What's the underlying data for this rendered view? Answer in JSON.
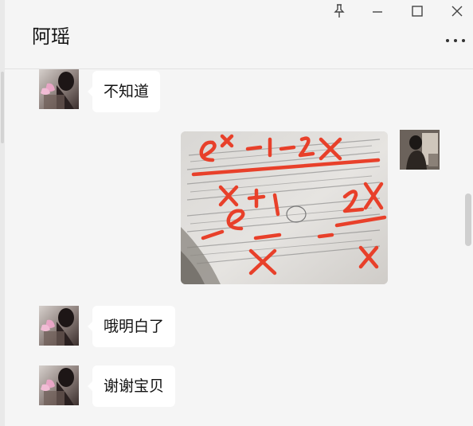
{
  "window": {
    "title": "阿瑶",
    "controls": [
      "pin-icon",
      "minimize-icon",
      "maximize-icon",
      "close-icon"
    ],
    "more_icon": "more-horizontal-icon"
  },
  "messages": [
    {
      "side": "left",
      "type": "text",
      "text": "不知道"
    },
    {
      "side": "right",
      "type": "image",
      "content": "handwritten-math-photo",
      "handwriting": [
        "e",
        "x",
        "-1-2x",
        "x+1",
        "2x",
        "e",
        "-",
        "x",
        "x"
      ]
    },
    {
      "side": "left",
      "type": "text",
      "text": "哦明白了"
    },
    {
      "side": "left",
      "type": "text",
      "text": "谢谢宝贝"
    }
  ],
  "colors": {
    "background": "#f5f5f5",
    "bubble": "#ffffff",
    "ink": "#e8402a"
  }
}
